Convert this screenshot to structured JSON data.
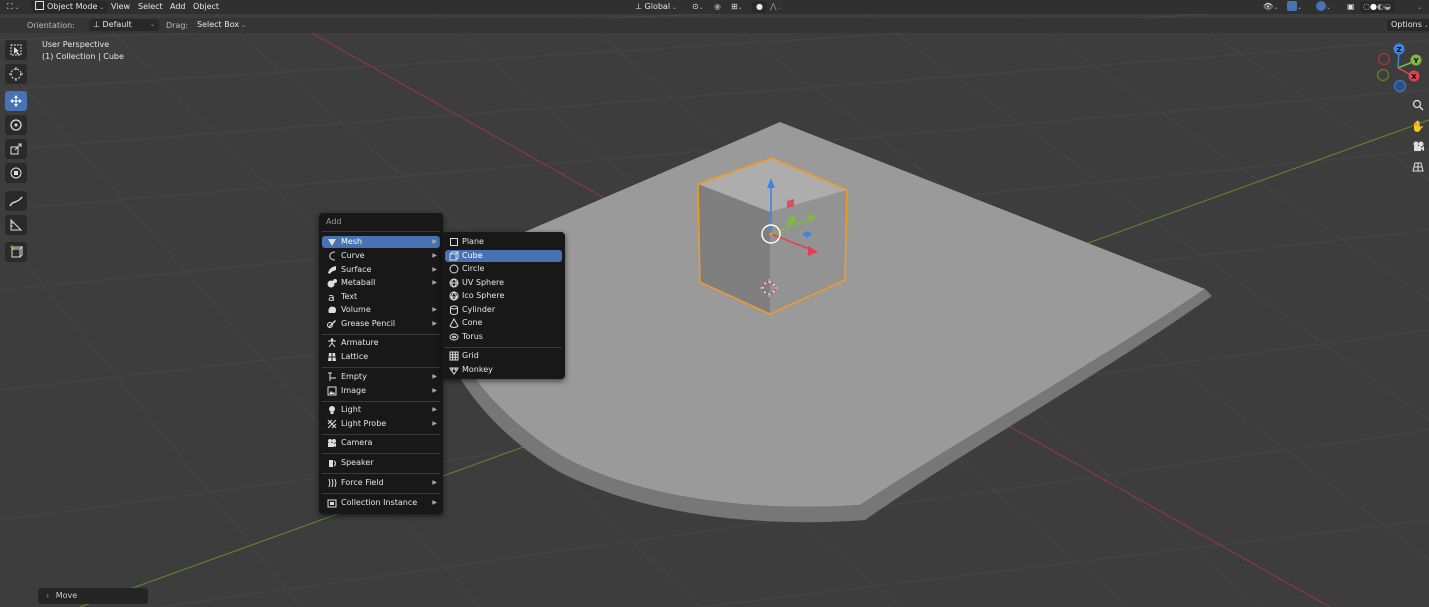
{
  "header": {
    "editor_icon": "3d-viewport-icon",
    "mode": "Object Mode",
    "menu": [
      "View",
      "Select",
      "Add",
      "Object"
    ],
    "orientation_transform": "Global",
    "options": "Options"
  },
  "tool_header": {
    "orientation_label": "Orientation:",
    "orientation_value": "Default",
    "drag_label": "Drag:",
    "drag_value": "Select Box"
  },
  "viewport_overlay": {
    "view": "User Perspective",
    "collection": "(1) Collection | Cube"
  },
  "tools": [
    "select-box",
    "cursor",
    "move",
    "rotate",
    "scale",
    "transform",
    "annotate",
    "measure",
    "add-cube"
  ],
  "active_tool": "move",
  "gizmo_axes": {
    "x": "X",
    "y": "Y",
    "z": "Z"
  },
  "add_menu": {
    "title": "Add",
    "items": [
      {
        "label": "Mesh",
        "icon": "mesh-icon",
        "submenu": true,
        "highlighted": true
      },
      {
        "label": "Curve",
        "icon": "curve-icon",
        "submenu": true
      },
      {
        "label": "Surface",
        "icon": "surface-icon",
        "submenu": true
      },
      {
        "label": "Metaball",
        "icon": "metaball-icon",
        "submenu": true
      },
      {
        "label": "Text",
        "icon": "text-icon",
        "submenu": false
      },
      {
        "label": "Volume",
        "icon": "volume-icon",
        "submenu": true
      },
      {
        "label": "Grease Pencil",
        "icon": "grease-pencil-icon",
        "submenu": true
      },
      {
        "label": "Armature",
        "icon": "armature-icon",
        "submenu": false
      },
      {
        "label": "Lattice",
        "icon": "lattice-icon",
        "submenu": false
      },
      {
        "label": "Empty",
        "icon": "empty-icon",
        "submenu": true
      },
      {
        "label": "Image",
        "icon": "image-icon",
        "submenu": true
      },
      {
        "label": "Light",
        "icon": "light-icon",
        "submenu": true
      },
      {
        "label": "Light Probe",
        "icon": "light-probe-icon",
        "submenu": true
      },
      {
        "label": "Camera",
        "icon": "camera-icon",
        "submenu": false
      },
      {
        "label": "Speaker",
        "icon": "speaker-icon",
        "submenu": false
      },
      {
        "label": "Force Field",
        "icon": "force-field-icon",
        "submenu": true
      },
      {
        "label": "Collection Instance",
        "icon": "collection-instance-icon",
        "submenu": true
      }
    ]
  },
  "mesh_submenu": {
    "items": [
      {
        "label": "Plane",
        "icon": "plane-icon"
      },
      {
        "label": "Cube",
        "icon": "cube-icon",
        "highlighted": true
      },
      {
        "label": "Circle",
        "icon": "circle-icon"
      },
      {
        "label": "UV Sphere",
        "icon": "uv-sphere-icon"
      },
      {
        "label": "Ico Sphere",
        "icon": "ico-sphere-icon"
      },
      {
        "label": "Cylinder",
        "icon": "cylinder-icon"
      },
      {
        "label": "Cone",
        "icon": "cone-icon"
      },
      {
        "label": "Torus",
        "icon": "torus-icon"
      },
      {
        "label": "Grid",
        "icon": "grid-icon"
      },
      {
        "label": "Monkey",
        "icon": "monkey-icon"
      }
    ]
  },
  "last_operator": "Move",
  "colors": {
    "accent": "#4772b3",
    "selection_outline": "#f59a23",
    "axis_x": "#e2424f",
    "axis_y": "#7fb93f",
    "axis_z": "#3c86e0"
  }
}
